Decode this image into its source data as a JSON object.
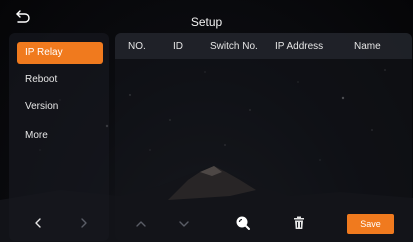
{
  "header": {
    "title": "Setup"
  },
  "sidebar": {
    "items": [
      {
        "label": "IP Relay",
        "active": true
      },
      {
        "label": "Reboot",
        "active": false
      },
      {
        "label": "Version",
        "active": false
      },
      {
        "label": "More",
        "active": false
      }
    ]
  },
  "table": {
    "columns": [
      "NO.",
      "ID",
      "Switch No.",
      "IP Address",
      "Name"
    ],
    "rows": []
  },
  "toolbar": {
    "save_label": "Save"
  },
  "icons": {
    "back": "back-arrow-icon",
    "prev": "chevron-left-icon",
    "next": "chevron-right-icon",
    "up": "chevron-up-icon",
    "down": "chevron-down-icon",
    "search": "search-icon",
    "delete": "trash-icon"
  },
  "colors": {
    "accent": "#f07a1e",
    "background": "#08090d"
  }
}
